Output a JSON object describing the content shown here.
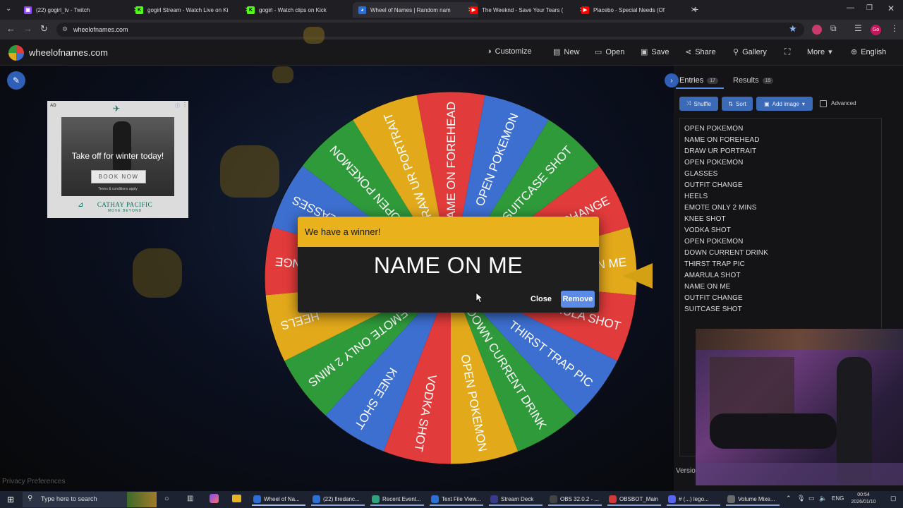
{
  "browser": {
    "tabs": [
      {
        "title": "(22) gogirl_tv - Twitch",
        "fav_color": "#9146ff",
        "fav_glyph": "▣"
      },
      {
        "title": "gogirl Stream - Watch Live on Ki",
        "fav_color": "#53fc18",
        "fav_glyph": "K"
      },
      {
        "title": "gogirl - Watch clips on Kick",
        "fav_color": "#53fc18",
        "fav_glyph": "K"
      },
      {
        "title": "Wheel of Names | Random nam",
        "fav_color": "#2c6fd6",
        "fav_glyph": "◕"
      },
      {
        "title": "The Weeknd - Save Your Tears (",
        "fav_color": "#ff0000",
        "fav_glyph": "▶"
      },
      {
        "title": "Placebo - Special Needs (Of",
        "fav_color": "#ff0000",
        "fav_glyph": "▶"
      }
    ],
    "url": "wheelofnames.com",
    "profile_initials": "Go"
  },
  "site": {
    "logo_text": "wheelofnames.com",
    "menu": [
      {
        "label": "Customize",
        "icon": "palette-icon"
      },
      {
        "label": "New",
        "icon": "new-file-icon"
      },
      {
        "label": "Open",
        "icon": "folder-icon"
      },
      {
        "label": "Save",
        "icon": "save-icon"
      },
      {
        "label": "Share",
        "icon": "share-icon"
      },
      {
        "label": "Gallery",
        "icon": "search-icon"
      },
      {
        "label": "More",
        "icon": "chevron-down-icon"
      },
      {
        "label": "English",
        "icon": "globe-icon"
      }
    ]
  },
  "ad": {
    "badge": "AD",
    "headline": "Take off for winter today!",
    "cta": "BOOK NOW",
    "fineprint": "Terms & conditions apply",
    "brand": "CATHAY PACIFIC",
    "tagline": "MOVE BEYOND"
  },
  "wheel": {
    "colors": [
      "#e23b3b",
      "#3d6fd0",
      "#e2a91b",
      "#2f9a3a"
    ],
    "segments": [
      "NAME ON FOREHEAD",
      "OPEN POKEMON",
      "SUITCASE SHOT",
      "OUTFIT CHANGE",
      "NAME ON ME",
      "AMARULA SHOT",
      "THIRST TRAP PIC",
      "DOWN CURRENT DRINK",
      "OPEN POKEMON",
      "VODKA SHOT",
      "KNEE SHOT",
      "EMOTE ONLY 2 MINS",
      "HEELS",
      "OUTFIT CHANGE",
      "GLASSES",
      "OPEN POKEMON",
      "DRAW UR PORTRAIT"
    ]
  },
  "dialog": {
    "header": "We have a winner!",
    "winner": "NAME ON ME",
    "close_label": "Close",
    "remove_label": "Remove"
  },
  "panel": {
    "tabs": [
      {
        "label": "Entries",
        "count": "17"
      },
      {
        "label": "Results",
        "count": "15"
      }
    ],
    "buttons": {
      "shuffle": "Shuffle",
      "sort": "Sort",
      "add_image": "Add image",
      "advanced": "Advanced"
    },
    "entries": [
      "OPEN POKEMON",
      "NAME ON FOREHEAD",
      "DRAW UR PORTRAIT",
      "OPEN POKEMON",
      "GLASSES",
      "OUTFIT CHANGE",
      "HEELS",
      "EMOTE ONLY 2 MINS",
      "KNEE SHOT",
      "VODKA SHOT",
      "OPEN POKEMON",
      "DOWN CURRENT DRINK",
      "THIRST TRAP PIC",
      "AMARULA SHOT",
      "NAME ON ME",
      "OUTFIT CHANGE",
      "SUITCASE SHOT"
    ],
    "version_label": "Versio"
  },
  "footer": {
    "privacy": "Privacy Preferences"
  },
  "taskbar": {
    "search_placeholder": "Type here to search",
    "apps": [
      {
        "label": "Wheel of Na...",
        "color": "#2c6fd6"
      },
      {
        "label": "(22) firedanc...",
        "color": "#2c6fd6"
      },
      {
        "label": "Recent Event...",
        "color": "#2fa37b"
      },
      {
        "label": "Text File View...",
        "color": "#2c6fd6"
      },
      {
        "label": "Stream Deck",
        "color": "#3a3a8a"
      },
      {
        "label": "OBS 32.0.2 - ...",
        "color": "#444444"
      },
      {
        "label": "OBSBOT_Main",
        "color": "#d23a3a"
      },
      {
        "label": "# (...) lego...",
        "color": "#5865f2"
      },
      {
        "label": "Volume Mixe...",
        "color": "#6a6a6a"
      }
    ],
    "language": "ENG",
    "time": "00:54",
    "date": "2026/01/10"
  }
}
